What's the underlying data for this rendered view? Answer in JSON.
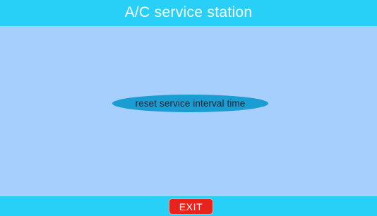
{
  "header": {
    "title": "A/C service station"
  },
  "main": {
    "action_label": "reset service interval time"
  },
  "footer": {
    "exit_label": "EXIT"
  },
  "colors": {
    "header_bar": "#28d0f7",
    "background": "#a6cffd",
    "action_button": "#1a9dd3",
    "exit_button": "#e8231c"
  }
}
